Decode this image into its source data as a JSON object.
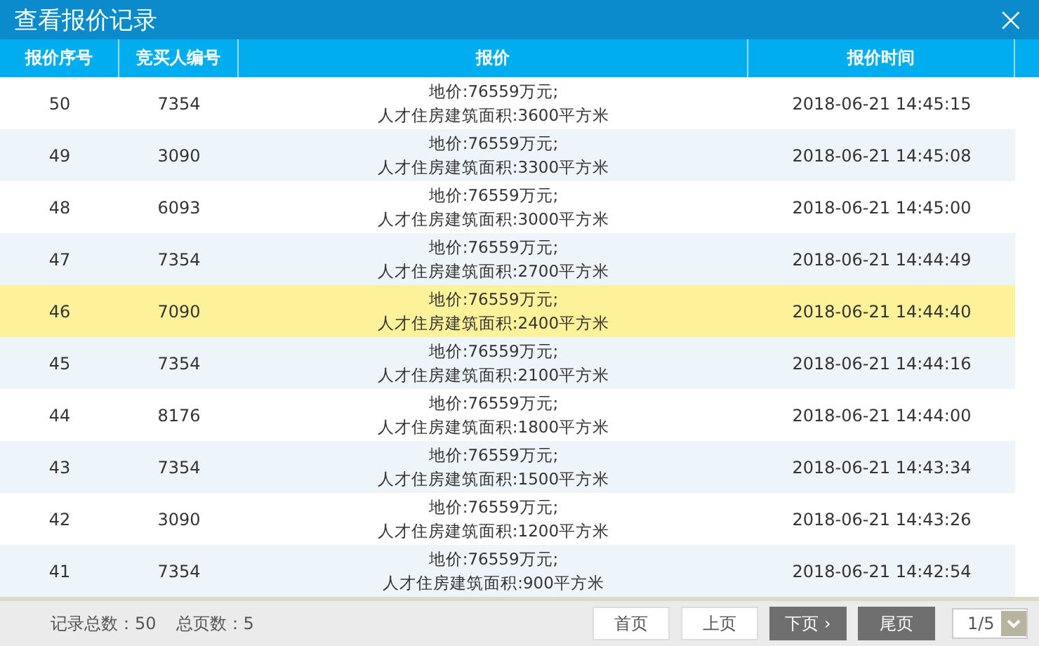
{
  "window": {
    "title": "查看报价记录",
    "close": "×"
  },
  "table": {
    "columns": [
      "报价序号",
      "竞买人编号",
      "报价",
      "报价时间"
    ],
    "rows": [
      {
        "seq": "50",
        "bidder": "7354",
        "price": "地价:76559万元;",
        "area": "人才住房建筑面积:3600平方米",
        "time": "2018-06-21 14:45:15",
        "selected": false
      },
      {
        "seq": "49",
        "bidder": "3090",
        "price": "地价:76559万元;",
        "area": "人才住房建筑面积:3300平方米",
        "time": "2018-06-21 14:45:08",
        "selected": false
      },
      {
        "seq": "48",
        "bidder": "6093",
        "price": "地价:76559万元;",
        "area": "人才住房建筑面积:3000平方米",
        "time": "2018-06-21 14:45:00",
        "selected": false
      },
      {
        "seq": "47",
        "bidder": "7354",
        "price": "地价:76559万元;",
        "area": "人才住房建筑面积:2700平方米",
        "time": "2018-06-21 14:44:49",
        "selected": false
      },
      {
        "seq": "46",
        "bidder": "7090",
        "price": "地价:76559万元;",
        "area": "人才住房建筑面积:2400平方米",
        "time": "2018-06-21 14:44:40",
        "selected": true
      },
      {
        "seq": "45",
        "bidder": "7354",
        "price": "地价:76559万元;",
        "area": "人才住房建筑面积:2100平方米",
        "time": "2018-06-21 14:44:16",
        "selected": false
      },
      {
        "seq": "44",
        "bidder": "8176",
        "price": "地价:76559万元;",
        "area": "人才住房建筑面积:1800平方米",
        "time": "2018-06-21 14:44:00",
        "selected": false
      },
      {
        "seq": "43",
        "bidder": "7354",
        "price": "地价:76559万元;",
        "area": "人才住房建筑面积:1500平方米",
        "time": "2018-06-21 14:43:34",
        "selected": false
      },
      {
        "seq": "42",
        "bidder": "3090",
        "price": "地价:76559万元;",
        "area": "人才住房建筑面积:1200平方米",
        "time": "2018-06-21 14:43:26",
        "selected": false
      },
      {
        "seq": "41",
        "bidder": "7354",
        "price": "地价:76559万元;",
        "area": "人才住房建筑面积:900平方米",
        "time": "2018-06-21 14:42:54",
        "selected": false
      }
    ]
  },
  "pager": {
    "total_records": "记录总数：50",
    "total_pages": "总页数：5",
    "buttons": [
      {
        "label": "首页",
        "disabled": true
      },
      {
        "label": "上页",
        "disabled": true
      },
      {
        "label": "下页",
        "arrow": "›",
        "disabled": false
      },
      {
        "label": "尾页",
        "disabled": false
      }
    ],
    "page_select": {
      "value": "1/5"
    }
  }
}
